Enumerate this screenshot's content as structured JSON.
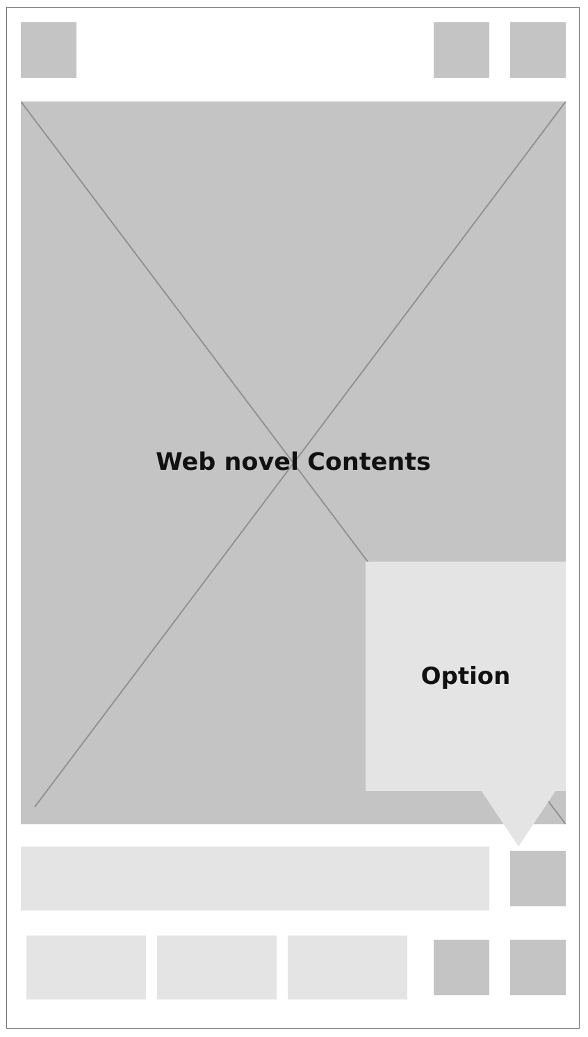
{
  "content": {
    "label": "Web novel Contents"
  },
  "option_popup": {
    "label": "Option"
  },
  "colors": {
    "placeholder_dark": "#c4c4c4",
    "placeholder_light": "#e4e4e4",
    "frame_border": "#6f6f6f",
    "cross_line": "#8f8f8f"
  }
}
